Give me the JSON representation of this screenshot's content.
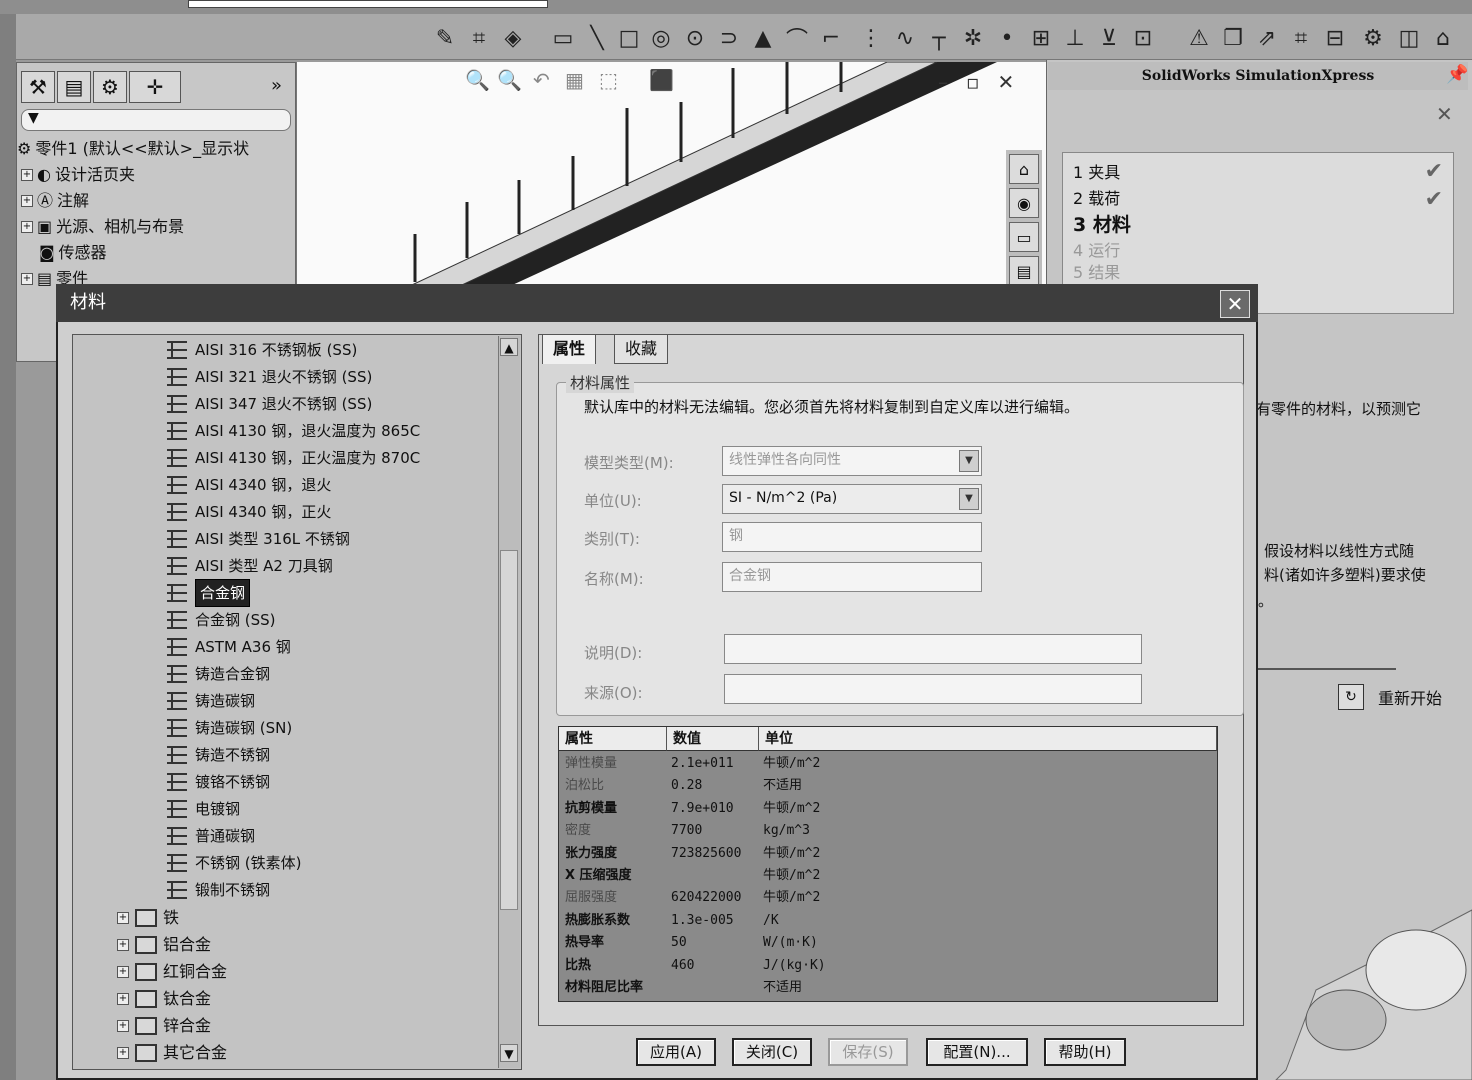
{
  "sim_pane": {
    "title": "SolidWorks SimulationXpress",
    "steps": [
      "1 夹具",
      "2 载荷",
      "3 材料",
      "4 运行",
      "5 结果"
    ],
    "body_fragment_1": "有零件的材料，以预测它",
    "body_fragment_2": "假设材料以线性方式随",
    "body_fragment_3": "料(诸如许多塑料)要求使",
    "body_fragment_4": "。",
    "restart_label": "重新开始"
  },
  "feature_tree": {
    "root_label": "零件1  (默认<<默认>_显示状",
    "items": [
      "设计活页夹",
      "注解",
      "光源、相机与布景",
      "传感器",
      "零件"
    ]
  },
  "dialog": {
    "title": "材料",
    "tabs": [
      "属性",
      "收藏"
    ],
    "tree_items": [
      "AISI 316 不锈钢板 (SS)",
      "AISI 321 退火不锈钢 (SS)",
      "AISI 347 退火不锈钢 (SS)",
      "AISI 4130 钢，退火温度为 865C",
      "AISI 4130 钢，正火温度为 870C",
      "AISI 4340 钢，退火",
      "AISI 4340 钢，正火",
      "AISI 类型 316L 不锈钢",
      "AISI 类型 A2 刀具钢",
      "合金钢",
      "合金钢 (SS)",
      "ASTM A36 钢",
      "铸造合金钢",
      "铸造碳钢",
      "铸造碳钢 (SN)",
      "铸造不锈钢",
      "镀铬不锈钢",
      "电镀钢",
      "普通碳钢",
      "不锈钢 (铁素体)",
      "锻制不锈钢"
    ],
    "selected_item": "合金钢",
    "tree_folders": [
      "铁",
      "铝合金",
      "红铜合金",
      "钛合金",
      "锌合金",
      "其它合金"
    ],
    "group_legend": "材料属性",
    "notice": "默认库中的材料无法编辑。您必须首先将材料复制到自定义库以进行编辑。",
    "fields": {
      "model_type_label": "模型类型(M):",
      "model_type_value": "线性弹性各向同性",
      "units_label": "单位(U):",
      "units_value": "SI - N/m^2 (Pa)",
      "category_label": "类别(T):",
      "category_value": "钢",
      "name_label": "名称(M):",
      "name_value": "合金钢",
      "description_label": "说明(D):",
      "description_value": "",
      "source_label": "来源(O):",
      "source_value": ""
    },
    "table": {
      "headers": [
        "属性",
        "数值",
        "单位"
      ],
      "rows": [
        {
          "prop": "弹性模量",
          "value": "2.1e+011",
          "unit": "牛顿/m^2",
          "bold": false
        },
        {
          "prop": "泊松比",
          "value": "0.28",
          "unit": "不适用",
          "bold": false
        },
        {
          "prop": "抗剪模量",
          "value": "7.9e+010",
          "unit": "牛顿/m^2",
          "bold": true
        },
        {
          "prop": "密度",
          "value": "7700",
          "unit": "kg/m^3",
          "bold": false
        },
        {
          "prop": "张力强度",
          "value": "723825600",
          "unit": "牛顿/m^2",
          "bold": true
        },
        {
          "prop": "X 压缩强度",
          "value": "",
          "unit": "牛顿/m^2",
          "bold": true
        },
        {
          "prop": "屈服强度",
          "value": "620422000",
          "unit": "牛顿/m^2",
          "bold": false
        },
        {
          "prop": "热膨胀系数",
          "value": "1.3e-005",
          "unit": "/K",
          "bold": true
        },
        {
          "prop": "热导率",
          "value": "50",
          "unit": "W/(m·K)",
          "bold": true
        },
        {
          "prop": "比热",
          "value": "460",
          "unit": "J/(kg·K)",
          "bold": true
        },
        {
          "prop": "材料阻尼比率",
          "value": "",
          "unit": "不适用",
          "bold": true
        }
      ]
    },
    "buttons": {
      "apply": "应用(A)",
      "close": "关闭(C)",
      "save": "保存(S)",
      "config": "配置(N)...",
      "help": "帮助(H)"
    }
  }
}
